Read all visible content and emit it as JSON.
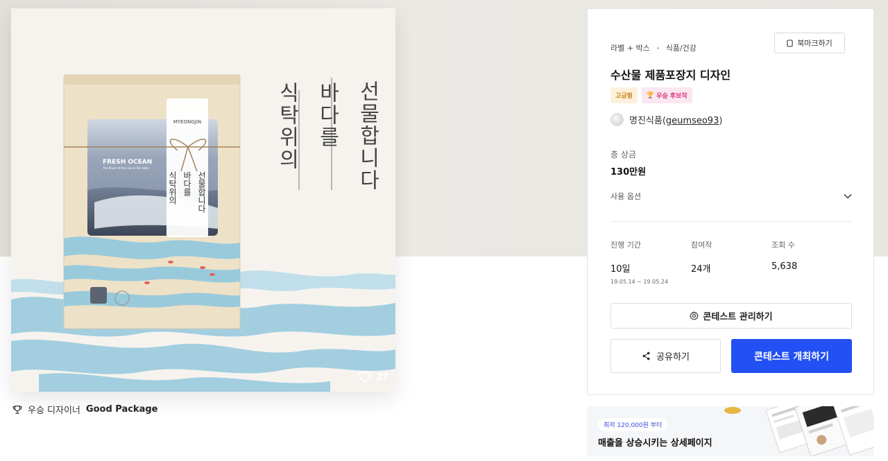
{
  "artwork": {
    "package_brand": "MYEONGJIN",
    "package_sub_brand": "FRESH OCEAN",
    "package_tagline": "The flavor of the sea on the table",
    "package_lines": [
      "선물합니다",
      "바다를",
      "식탁위의"
    ],
    "background_lines": [
      "선물합니다",
      "바다를",
      "식탁위의"
    ],
    "like_count": "27"
  },
  "winner": {
    "prefix": "우승 디자이너",
    "name": "Good Package"
  },
  "contest": {
    "breadcrumb": [
      "라벨 + 박스",
      "식품/건강"
    ],
    "bookmark_label": "북마크하기",
    "title": "수산물 제품포장지 디자인",
    "badges": {
      "grade": "고급형",
      "award": "우승 후보작"
    },
    "host_name": "명진식품",
    "host_handle": "geumseo93",
    "prize_label": "총 상금",
    "prize_value": "130만원",
    "usage_label": "사용 옵션",
    "stats": {
      "period_label": "진행 기간",
      "period_value": "10일",
      "period_range": "19.05.14 ~ 19.05.24",
      "entries_label": "참여작",
      "entries_value": "24개",
      "views_label": "조회 수",
      "views_value": "5,638"
    },
    "manage_label": "콘테스트 관리하기",
    "share_label": "공유하기",
    "host_label": "콘테스트 개최하기",
    "accent_color": "#2250f4"
  },
  "ad": {
    "pill": "최저 120,000원 부터",
    "headline": "매출을 상승시키는 상세페이지"
  }
}
